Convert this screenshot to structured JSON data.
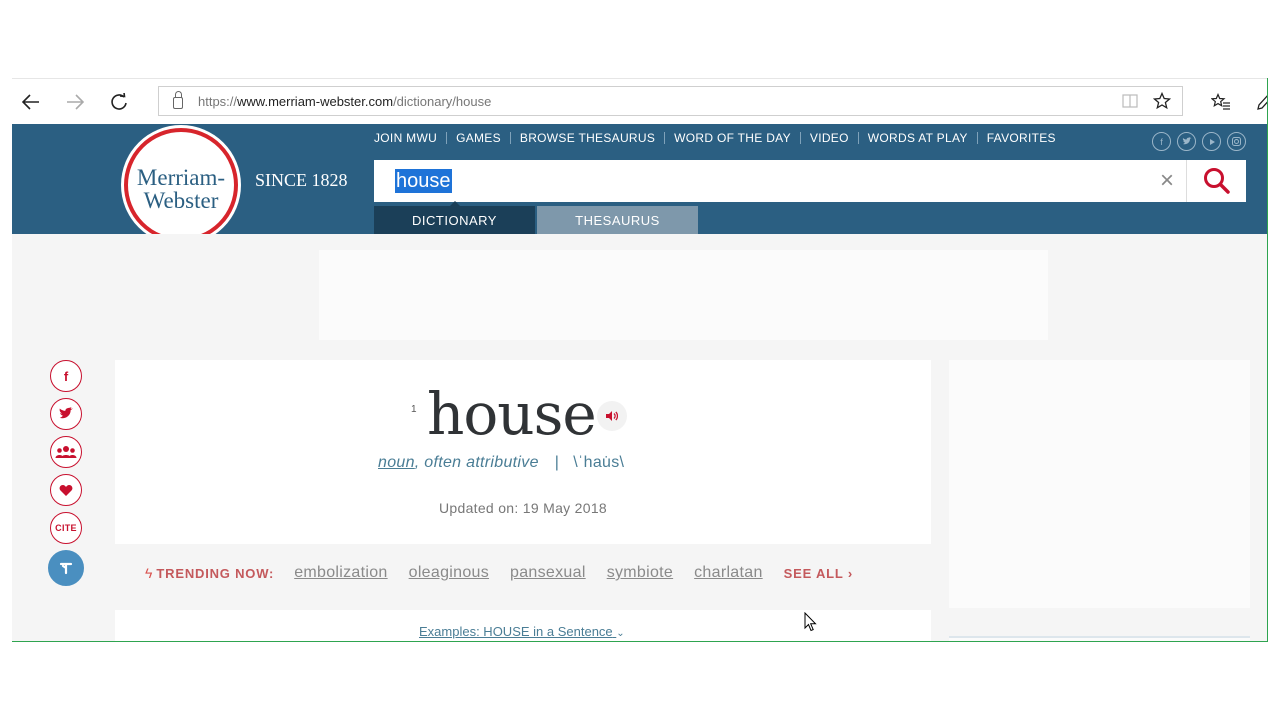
{
  "browser": {
    "url_prefix": "https://",
    "url_domain": "www.merriam-webster.com",
    "url_path": "/dictionary/house"
  },
  "header": {
    "logo_line1": "Merriam-",
    "logo_line2": "Webster",
    "since": "SINCE 1828",
    "nav": [
      "JOIN MWU",
      "GAMES",
      "BROWSE THESAURUS",
      "WORD OF THE DAY",
      "VIDEO",
      "WORDS AT PLAY",
      "FAVORITES"
    ],
    "search_value": "house",
    "tab_dictionary": "DICTIONARY",
    "tab_thesaurus": "THESAURUS"
  },
  "share": {
    "cite_label": "CITE"
  },
  "entry": {
    "homograph": "1",
    "headword": "house",
    "pos": "noun",
    "pos_extra": ", often attributive",
    "separator": "|",
    "pronunciation": "\\ˈhau̇s\\",
    "updated": "Updated on: 19 May 2018"
  },
  "trending": {
    "label": "TRENDING NOW:",
    "words": [
      "embolization",
      "oleaginous",
      "pansexual",
      "symbiote",
      "charlatan"
    ],
    "see_all": "SEE ALL ›"
  },
  "examples": {
    "label": "Examples: HOUSE in a Sentence"
  },
  "colors": {
    "brand_blue": "#2b5f82",
    "brand_red": "#d7252c",
    "selection": "#1e73d8"
  }
}
